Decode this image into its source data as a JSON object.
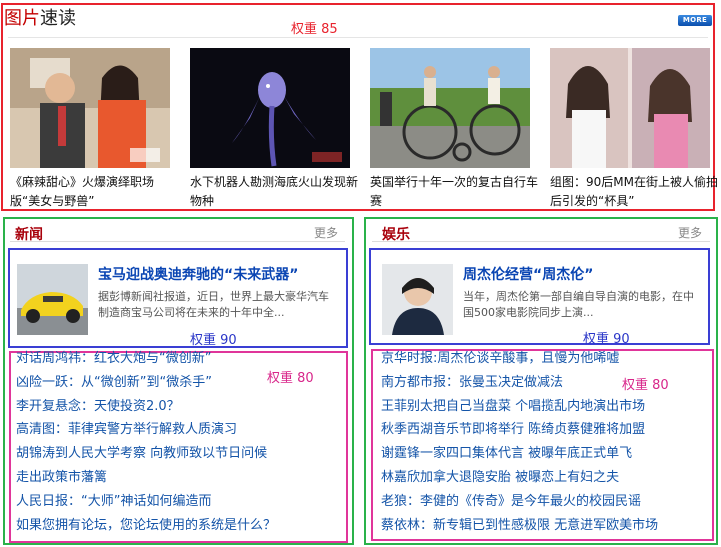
{
  "pictures": {
    "title_red": "图片",
    "title_rest": "速读",
    "weight_label": "权重  85",
    "more_label": "MORE",
    "items": [
      {
        "caption": "《麻辣甜心》火爆演绎职场版“美女与野兽”"
      },
      {
        "caption": "水下机器人勘测海底火山发现新物种"
      },
      {
        "caption": "英国举行十年一次的复古自行车赛"
      },
      {
        "caption": "组图：90后MM在街上被人偷拍后引发的“杯具”"
      }
    ]
  },
  "news": {
    "title": "新闻",
    "more": "更多",
    "featured": {
      "title": "宝马迎战奥迪奔驰的“未来武器”",
      "desc": "据彭博新闻社报道，近日，世界上最大豪华汽车制造商宝马公司将在未来的十年中全..."
    },
    "featured_weight": "权重  90",
    "list_weight": "权重  80",
    "list": [
      "对话周鸿祎：红衣大炮与“微创新”",
      "凶险一跃：从“微创新”到“微杀手”",
      "李开复悬念：天使投资2.0？",
      "高清图：菲律宾警方举行解救人质演习",
      "胡锦涛到人民大学考察  向教师致以节日问候",
      "走出政策市藩篱",
      "人民日报：“大师”神话如何编造而",
      "如果您拥有论坛，您论坛使用的系统是什么？"
    ]
  },
  "ent": {
    "title": "娱乐",
    "more": "更多",
    "featured": {
      "title": "周杰伦经营“周杰伦”",
      "desc": "当年，周杰伦第一部自编自导自演的电影，在中国500家电影院同步上演..."
    },
    "featured_weight": "权重  90",
    "list_weight": "权重  80",
    "list": [
      "京华时报:周杰伦谈辛酸事，且慢为他唏嘘",
      "南方都市报：张曼玉决定做减法",
      "王菲别太把自己当盘菜  个唱揽乱内地演出市场",
      "秋季西湖音乐节即将举行  陈绮贞蔡健雅将加盟",
      "谢霆锋一家四口集体代言  被曝年底正式单飞",
      "林嘉欣加拿大退隐安胎  被曝恋上有妇之夫",
      "老狼：李健的《传奇》是今年最火的校园民谣",
      "蔡依林：新专辑已到性感极限  无意进军欧美市场"
    ]
  },
  "colors": {
    "picture_border": "#e8232d",
    "section_border": "#2ab24a",
    "featured_border": "#3a3fd4",
    "list_border": "#e0359a",
    "link": "#1454a8",
    "headline": "#0a45b3"
  }
}
